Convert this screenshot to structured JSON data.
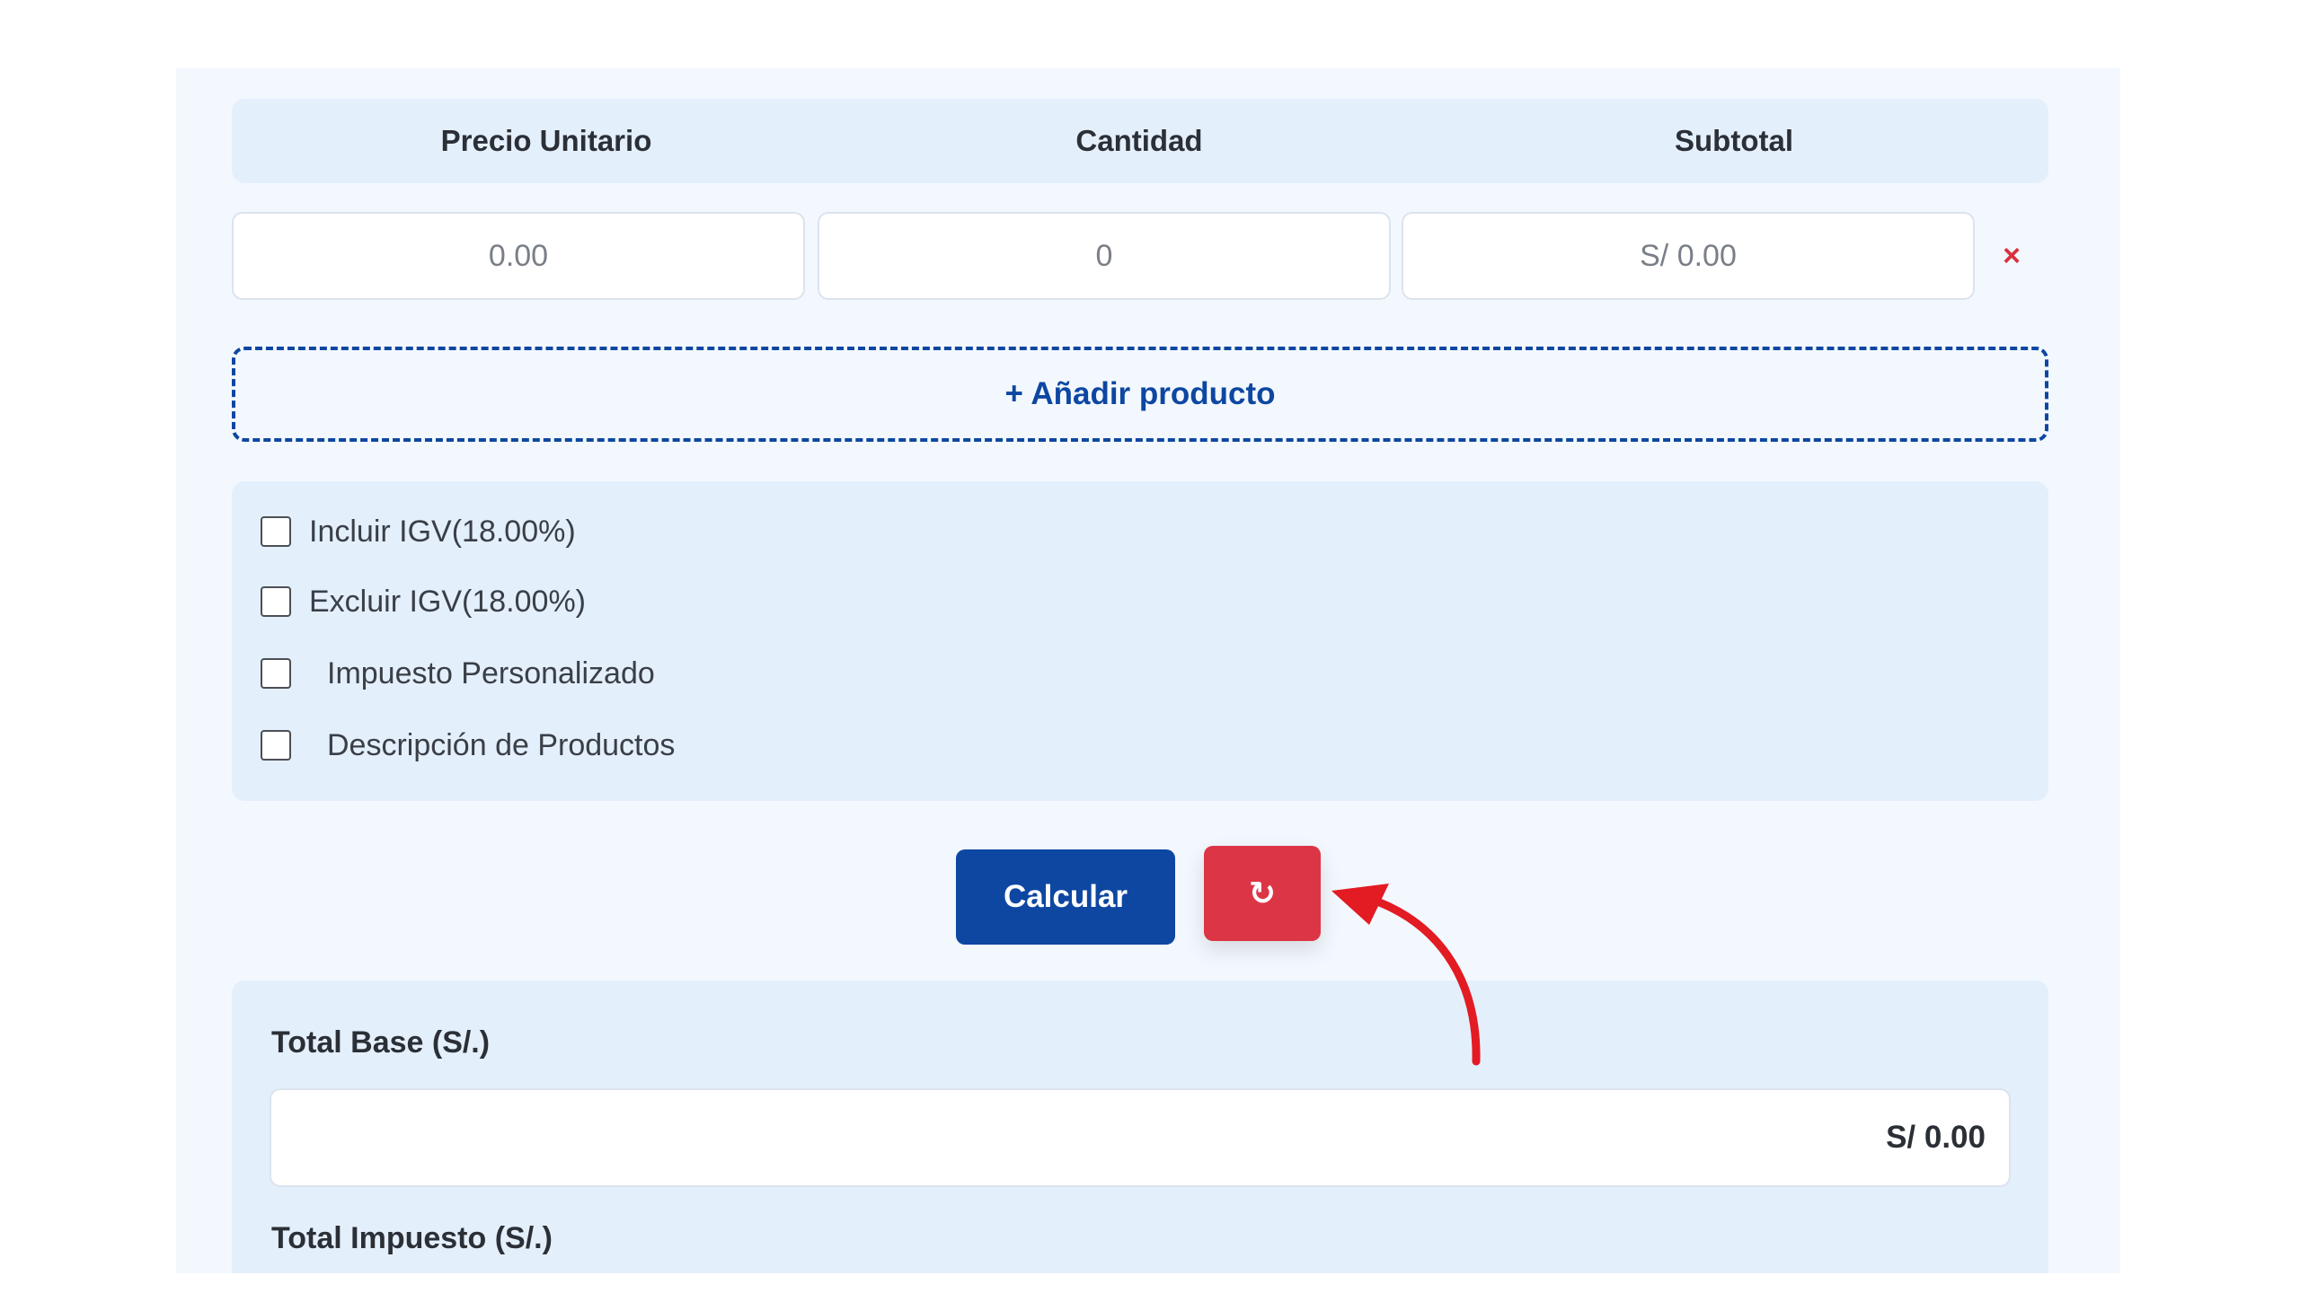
{
  "table_header": {
    "price_label": "Precio Unitario",
    "quantity_label": "Cantidad",
    "subtotal_label": "Subtotal"
  },
  "row": {
    "price_value": "0.00",
    "quantity_value": "0",
    "subtotal_value": "S/ 0.00",
    "remove_label": "×"
  },
  "add_product_label": "+ Añadir producto",
  "options": [
    {
      "label": "Incluir IGV(18.00%)",
      "checked": false
    },
    {
      "label": "Excluir IGV(18.00%)",
      "checked": false
    },
    {
      "label": "Impuesto Personalizado",
      "checked": false
    },
    {
      "label": "Descripción de Productos",
      "checked": false
    }
  ],
  "buttons": {
    "calculate_label": "Calcular",
    "reset_label": "↻"
  },
  "results": {
    "total_base_label": "Total Base (S/.)",
    "total_base_value": "S/ 0.00",
    "total_tax_label": "Total Impuesto (S/.)"
  },
  "colors": {
    "primary": "#0d47a1",
    "danger": "#dc3545",
    "annotation_arrow": "#e31b23"
  },
  "icons": {
    "remove": "close-icon",
    "reset": "refresh-icon",
    "annotation": "curved-arrow-icon"
  }
}
